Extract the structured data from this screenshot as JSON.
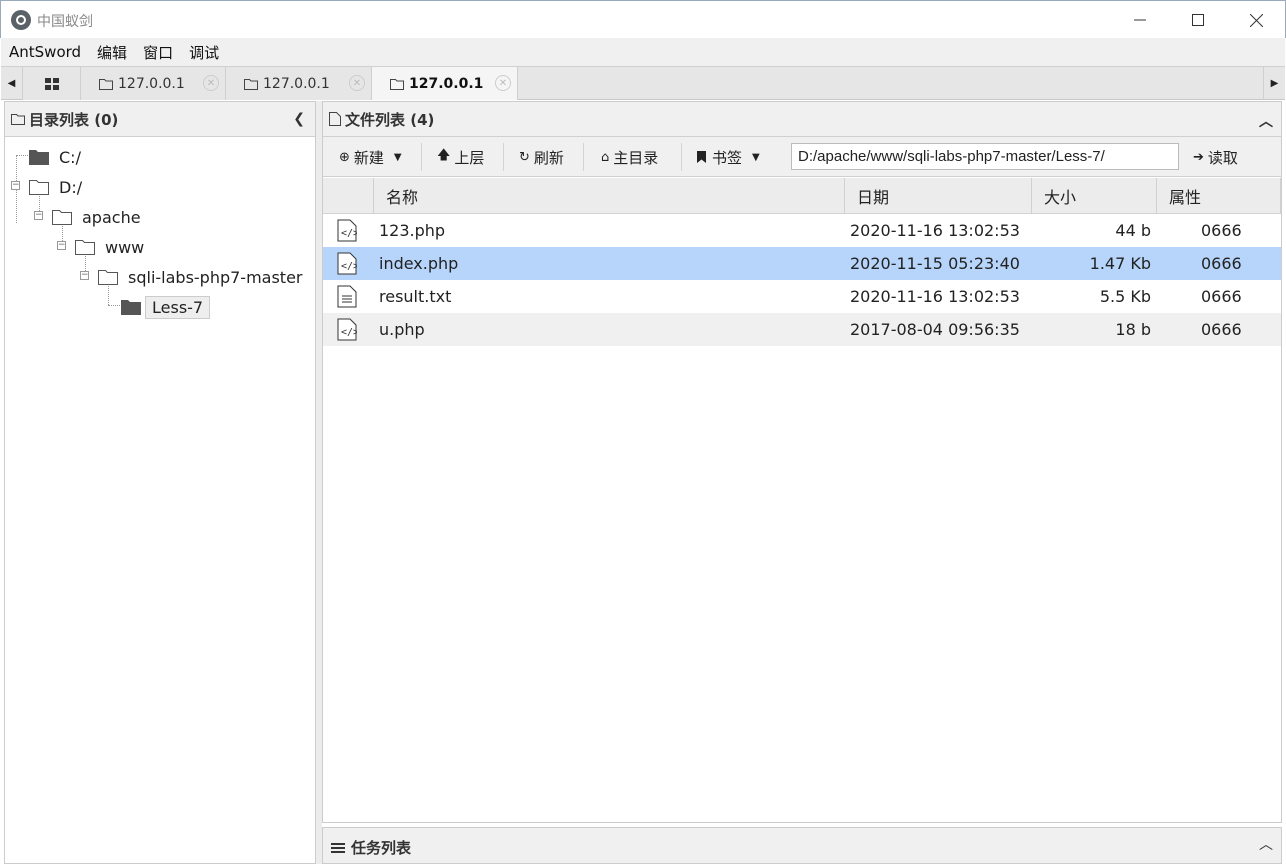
{
  "window": {
    "title": "中国蚁剑"
  },
  "menu": [
    "AntSword",
    "编辑",
    "窗口",
    "调试"
  ],
  "tabs": [
    {
      "label": "127.0.0.1",
      "active": false
    },
    {
      "label": "127.0.0.1",
      "active": false
    },
    {
      "label": "127.0.0.1",
      "active": true
    }
  ],
  "left": {
    "header": "目录列表 (0)",
    "tree": [
      {
        "label": "C:/",
        "depth": 0
      },
      {
        "label": "D:/",
        "depth": 0
      },
      {
        "label": "apache",
        "depth": 1
      },
      {
        "label": "www",
        "depth": 2
      },
      {
        "label": "sqli-labs-php7-master",
        "depth": 3
      },
      {
        "label": "Less-7",
        "depth": 4,
        "selected": true
      }
    ]
  },
  "right": {
    "header": "文件列表 (4)",
    "toolbar": {
      "new": "新建",
      "up": "上层",
      "refresh": "刷新",
      "home": "主目录",
      "bookmark": "书签",
      "path": "D:/apache/www/sqli-labs-php7-master/Less-7/",
      "read": "读取"
    },
    "columns": [
      "名称",
      "日期",
      "大小",
      "属性"
    ],
    "files": [
      {
        "name": "123.php",
        "date": "2020-11-16 13:02:53",
        "size": "44 b",
        "attr": "0666",
        "type": "code"
      },
      {
        "name": "index.php",
        "date": "2020-11-15 05:23:40",
        "size": "1.47 Kb",
        "attr": "0666",
        "type": "code",
        "selected": true
      },
      {
        "name": "result.txt",
        "date": "2020-11-16 13:02:53",
        "size": "5.5 Kb",
        "attr": "0666",
        "type": "text"
      },
      {
        "name": "u.php",
        "date": "2017-08-04 09:56:35",
        "size": "18 b",
        "attr": "0666",
        "type": "code"
      }
    ]
  },
  "task": {
    "header": "任务列表"
  }
}
